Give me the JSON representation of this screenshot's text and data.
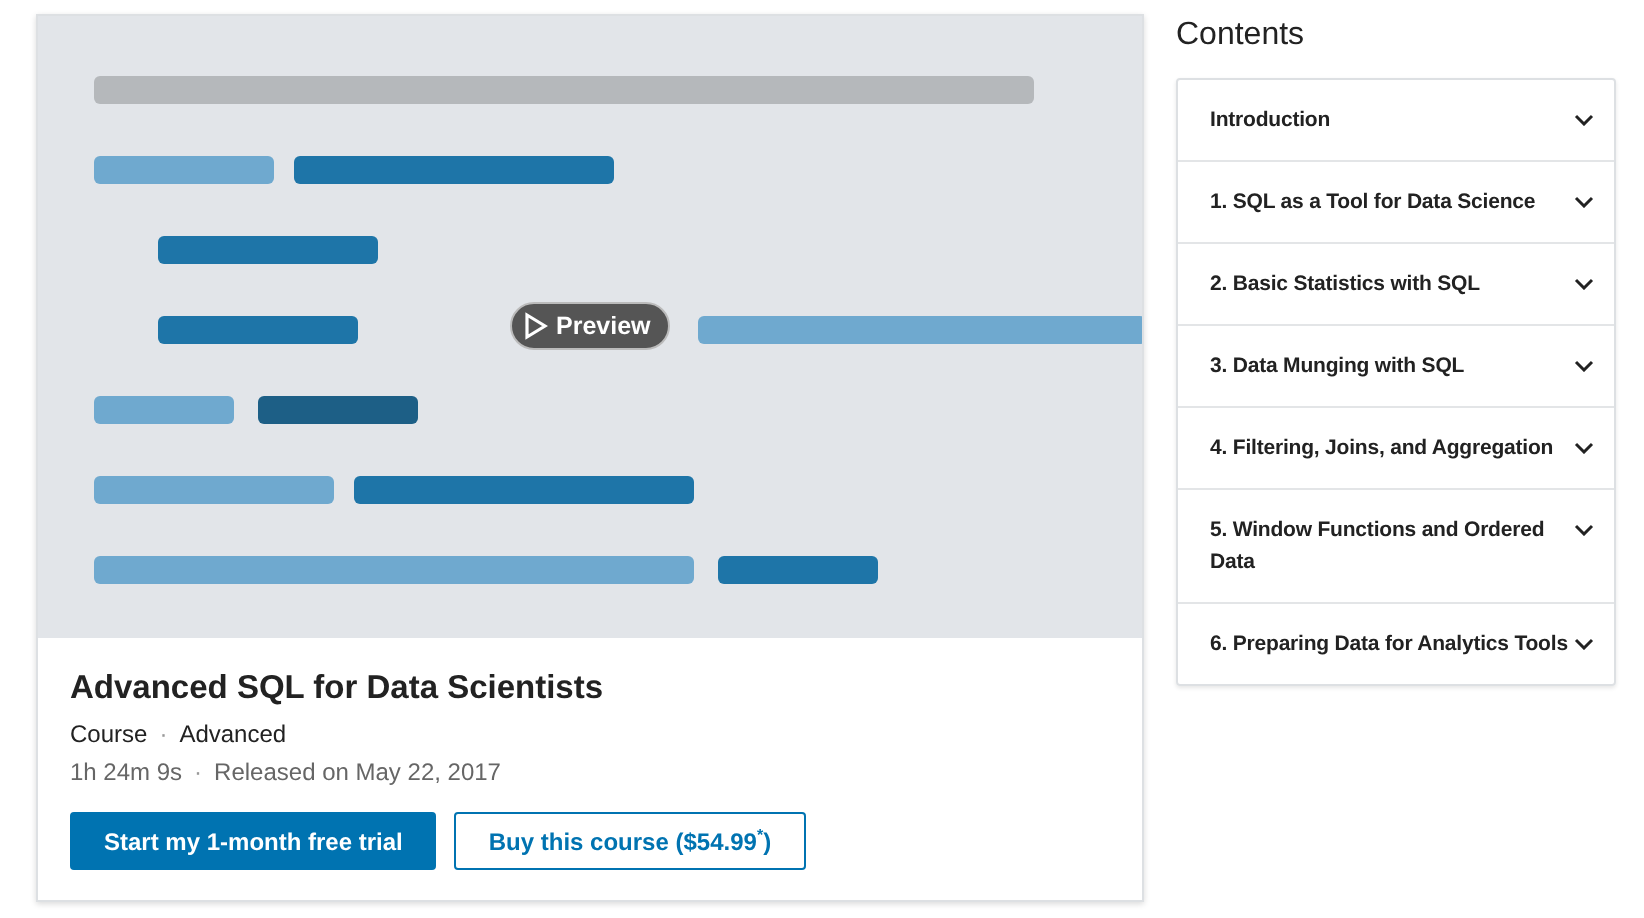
{
  "course": {
    "preview": {
      "kind": "picture",
      "label": "Preview"
    },
    "title": "Advanced SQL for Data Scientists",
    "type": "Course",
    "type_separator": "·",
    "level": "Advanced",
    "duration": "1h 24m 9s",
    "date_separator": "·",
    "released": "Released on May 22, 2017",
    "buttons": [
      {
        "kind": "primary",
        "label": "Start my 1-month free trial"
      },
      {
        "kind": "outline",
        "label": "Buy this course ($54.99$^{*}$)"
      }
    ]
  },
  "contents": {
    "title": "Contents",
    "sections": [
      {
        "label": "Introduction",
        "expanded": false
      },
      {
        "label": "1. SQL as a Tool for Data Science",
        "expanded": false
      },
      {
        "label": "2. Basic Statistics with SQL",
        "expanded": false
      },
      {
        "label": "3. Data Munging with SQL",
        "expanded": false
      },
      {
        "label": "4. Filtering, Joins, and Aggregation",
        "expanded": false
      },
      {
        "label": "5. Window Functions and Ordered Data",
        "expanded": false
      },
      {
        "label": "6. Preparing Data for Analytics Tools",
        "expanded": false
      }
    ]
  }
}
